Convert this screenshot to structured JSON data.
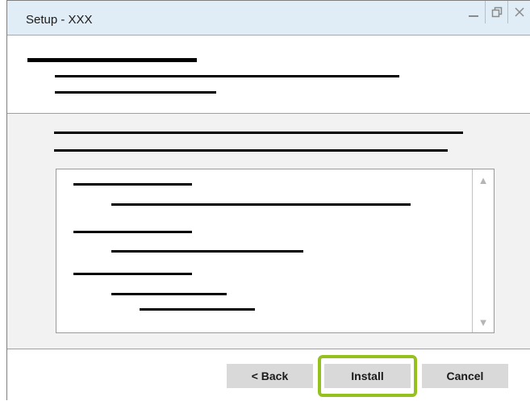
{
  "window": {
    "title": "Setup - XXX",
    "controls": {
      "minimize_icon": "minimize-icon",
      "restore_icon": "restore-icon",
      "close_icon": "close-icon"
    }
  },
  "footer": {
    "back_label": "< Back",
    "install_label": "Install",
    "cancel_label": "Cancel",
    "highlight_color": "#95c11f"
  },
  "listbox": {
    "scroll_up_glyph": "▲",
    "scroll_down_glyph": "▼"
  },
  "colors": {
    "titlebar": "#e0ecf6",
    "main_background": "#f2f2f2",
    "button": "#d9d9d9"
  }
}
